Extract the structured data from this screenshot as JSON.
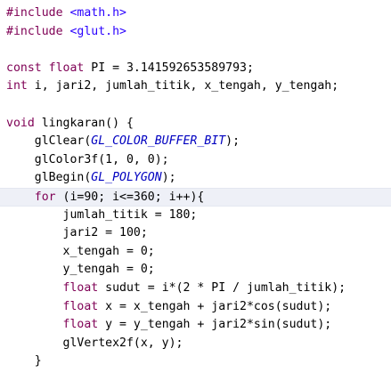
{
  "editor": {
    "lines": [
      [
        {
          "t": "#include ",
          "c": "pp"
        },
        {
          "t": "<math.h>",
          "c": "str"
        }
      ],
      [
        {
          "t": "#include ",
          "c": "pp"
        },
        {
          "t": "<glut.h>",
          "c": "str"
        }
      ],
      [],
      [
        {
          "t": "const float",
          "c": "kw"
        },
        {
          "t": " PI = 3.141592653589793;",
          "c": "plain"
        }
      ],
      [
        {
          "t": "int",
          "c": "kw"
        },
        {
          "t": " i, jari2, jumlah_titik, x_tengah, y_tengah;",
          "c": "plain"
        }
      ],
      [],
      [
        {
          "t": "void",
          "c": "kw"
        },
        {
          "t": " lingkaran() {",
          "c": "plain"
        }
      ],
      [
        {
          "t": "    glClear(",
          "c": "plain"
        },
        {
          "t": "GL_COLOR_BUFFER_BIT",
          "c": "macro"
        },
        {
          "t": ");",
          "c": "plain"
        }
      ],
      [
        {
          "t": "    glColor3f(1, 0, 0);",
          "c": "plain"
        }
      ],
      [
        {
          "t": "    glBegin(",
          "c": "plain"
        },
        {
          "t": "GL_POLYGON",
          "c": "macro"
        },
        {
          "t": ");",
          "c": "plain"
        }
      ],
      [
        {
          "t": "    ",
          "c": "plain"
        },
        {
          "t": "for",
          "c": "kw"
        },
        {
          "t": " (i=90; i<=360; i++){",
          "c": "plain"
        }
      ],
      [
        {
          "t": "        jumlah_titik = 180;",
          "c": "plain"
        }
      ],
      [
        {
          "t": "        jari2 = 100;",
          "c": "plain"
        }
      ],
      [
        {
          "t": "        x_tengah = 0;",
          "c": "plain"
        }
      ],
      [
        {
          "t": "        y_tengah = 0;",
          "c": "plain"
        }
      ],
      [
        {
          "t": "        ",
          "c": "plain"
        },
        {
          "t": "float",
          "c": "kw"
        },
        {
          "t": " sudut = i*(2 * PI / jumlah_titik);",
          "c": "plain"
        }
      ],
      [
        {
          "t": "        ",
          "c": "plain"
        },
        {
          "t": "float",
          "c": "kw"
        },
        {
          "t": " x = x_tengah + jari2*cos(sudut);",
          "c": "plain"
        }
      ],
      [
        {
          "t": "        ",
          "c": "plain"
        },
        {
          "t": "float",
          "c": "kw"
        },
        {
          "t": " y = y_tengah + jari2*sin(sudut);",
          "c": "plain"
        }
      ],
      [
        {
          "t": "        glVertex2f(x, y);",
          "c": "plain"
        }
      ],
      [
        {
          "t": "    }",
          "c": "plain"
        }
      ]
    ],
    "current_line_index": 10,
    "colors": {
      "keyword": "#7f0055",
      "string": "#2a00ff",
      "macro": "#0000c0",
      "text": "#000000",
      "current_line": "#eef0f7"
    }
  }
}
